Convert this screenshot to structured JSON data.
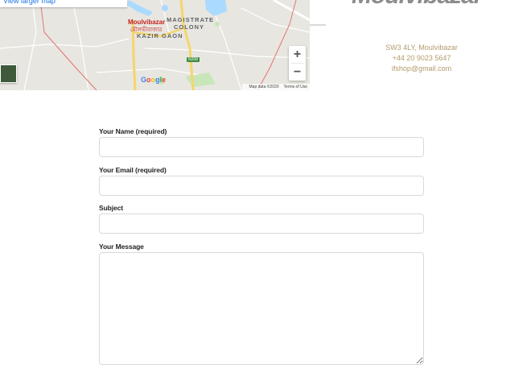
{
  "map": {
    "larger_map_link": "View larger map",
    "labels": {
      "town": "Moulvibazar",
      "town_bengali": "মৌলভীবাজার",
      "colony": "MAGISTRATE COLONY",
      "kazir_gaon": "KAZIR GAON",
      "road_badge": "N208",
      "google": "Google"
    },
    "attribution": {
      "map_data": "Map data ©2020",
      "terms": "Terms of Use"
    },
    "zoom_in": "+",
    "zoom_out": "−"
  },
  "location": {
    "title": "Moulvibazar",
    "address_line": "SW3 4LY, Moulvibazar",
    "phone": "+44 20 9023 5647",
    "email": "ifshop@gmail.com"
  },
  "form": {
    "name_label": "Your Name (required)",
    "email_label": "Your Email (required)",
    "subject_label": "Subject",
    "message_label": "Your Message"
  },
  "colors": {
    "accent_text": "#b39a6b",
    "title_gray": "#8c8c8c"
  }
}
